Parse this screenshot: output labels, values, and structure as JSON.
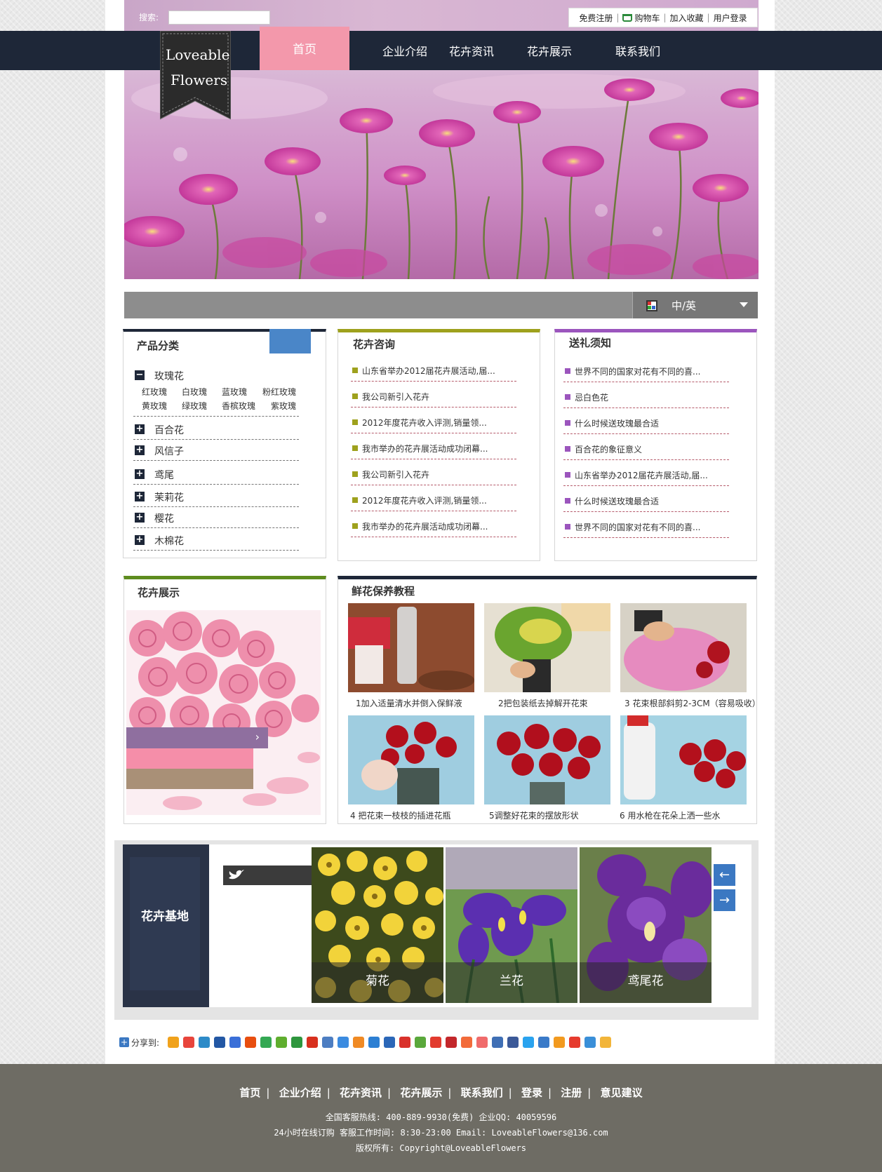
{
  "header": {
    "search_label": "搜索:",
    "top_links": [
      "免费注册",
      "购物车",
      "加入收藏",
      "用户登录"
    ]
  },
  "logo": {
    "line1": "Loveable",
    "line2": "Flowers"
  },
  "nav": {
    "items": [
      "首页",
      "企业介绍",
      "花卉资讯",
      "花卉展示",
      "联系我们"
    ]
  },
  "lang": {
    "label": "中/英"
  },
  "categories": {
    "title": "产品分类",
    "expanded": {
      "label": "玫瑰花",
      "subs": [
        "红玫瑰",
        "白玫瑰",
        "蓝玫瑰",
        "粉红玫瑰",
        "黄玫瑰",
        "绿玫瑰",
        "香槟玫瑰",
        "紫玫瑰"
      ]
    },
    "items": [
      "百合花",
      "风信子",
      "鸢尾",
      "茉莉花",
      "樱花",
      "木棉花"
    ]
  },
  "news": {
    "title": "花卉咨询",
    "items": [
      "山东省举办2012届花卉展活动,届...",
      "我公司新引入花卉",
      "2012年度花卉收入评测,销量领...",
      "我市举办的花卉展活动成功闭幕...",
      "我公司新引入花卉",
      "2012年度花卉收入评测,销量领...",
      "我市举办的花卉展活动成功闭幕..."
    ],
    "accent": "#9ea11d"
  },
  "gift": {
    "title": "送礼须知",
    "items": [
      "世界不同的国家对花有不同的喜...",
      "忌白色花",
      "什么时候送玫瑰最合适",
      "百合花的象征意义",
      "山东省举办2012届花卉展活动,届...",
      "什么时候送玫瑰最合适",
      "世界不同的国家对花有不同的喜..."
    ],
    "accent": "#9b55bd"
  },
  "showcase": {
    "title": "花卉展示"
  },
  "care": {
    "title": "鲜花保养教程",
    "steps": [
      "1加入适量清水并倒入保鲜液",
      "2把包装纸去掉解开花束",
      "3 花束根部斜剪2-3CM（容易吸收）",
      "4 把花束一枝枝的插进花瓶",
      "5调整好花束的摆放形状",
      "6 用水枪在花朵上洒一些水"
    ]
  },
  "base": {
    "title": "花卉基地",
    "flowers": [
      "菊花",
      "兰花",
      "鸢尾花"
    ]
  },
  "share": {
    "label": "分享到:"
  },
  "footer": {
    "links": [
      "首页",
      "企业介绍",
      "花卉资讯",
      "花卉展示",
      "联系我们",
      "登录",
      "注册",
      "意见建议"
    ],
    "hotline": "全国客服热线: 400-889-9930(免费)   企业QQ: 40059596",
    "hours": "24小时在线订购  客服工作时间: 8:30-23:00  Email: LoveableFlowers@136.com",
    "copyright": "版权所有: Copyright@LoveableFlowers"
  },
  "colors": {
    "nav_bg": "#1e2738",
    "nav_active": "#f398ab",
    "categories_accent": "#1e2738",
    "care_accent": "#1e2738",
    "showcase_accent": "#5e8c1f",
    "footer_bg": "#6e6c64"
  },
  "icons": [
    "search-input",
    "cart-icon",
    "flag-icon",
    "dropdown-arrow-icon",
    "minus-icon",
    "plus-icon",
    "chevron-right-icon",
    "twitter-bird-icon",
    "arrow-left-icon",
    "arrow-right-icon",
    "share-icon"
  ]
}
